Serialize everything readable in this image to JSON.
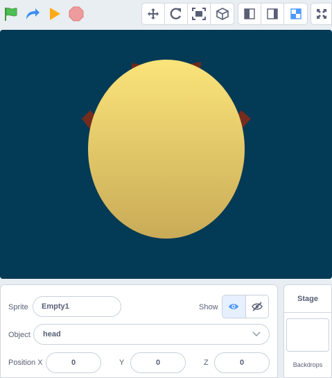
{
  "toolbar": {
    "green_flag": "green-flag-icon",
    "restart": "restart-icon",
    "run": "run-icon",
    "stop": "stop-icon",
    "view_group": [
      "move-icon",
      "rotate-icon",
      "fit-view-icon",
      "cube-icon"
    ],
    "layout_group": [
      "small-stage-icon",
      "large-stage-icon",
      "split-icon"
    ],
    "fullscreen": "fullscreen-icon"
  },
  "colors": {
    "stage_bg": "#033a55",
    "head_top": "#fbe47a",
    "head_bottom": "#c9ab57",
    "bow": "#7a2f22",
    "accent": "#4c97ff",
    "flag": "#4cbf56",
    "run": "#ffab19",
    "stop": "#ec9c9c"
  },
  "sprite": {
    "label": "Sprite",
    "name": "Empty1",
    "show_label": "Show",
    "object_label": "Object",
    "object_value": "head",
    "position": {
      "x_label": "Position X",
      "x": "0",
      "y_label": "Y",
      "y": "0",
      "z_label": "Z",
      "z": "0"
    }
  },
  "stage_panel": {
    "title": "Stage",
    "backdrops_label": "Backdrops"
  }
}
